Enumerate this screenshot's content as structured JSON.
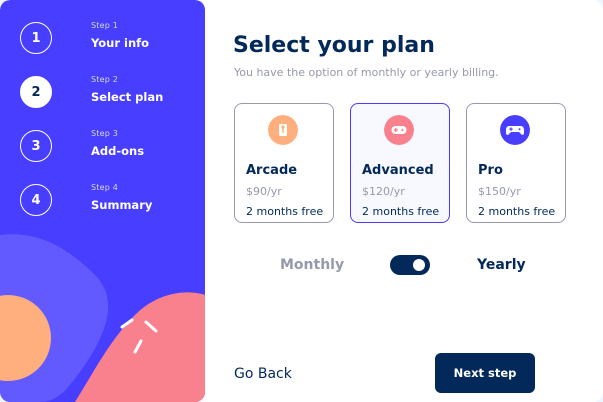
{
  "sidebar": {
    "steps": [
      {
        "circle": "1",
        "step": "Step 1",
        "label": "Your info",
        "active": false
      },
      {
        "circle": "2",
        "step": "Step 2",
        "label": "Select plan",
        "active": true
      },
      {
        "circle": "3",
        "step": "Step 3",
        "label": "Add-ons",
        "active": false
      },
      {
        "circle": "4",
        "step": "Step 4",
        "label": "Summary",
        "active": false
      }
    ]
  },
  "main": {
    "title": "Select your plan",
    "subtitle": "You have the option of monthly or yearly billing.",
    "plans": [
      {
        "icon": "arcade-icon",
        "name": "Arcade",
        "price": "$90/yr",
        "free": "2 months free",
        "selected": false,
        "icon_color": "#ffaf7e"
      },
      {
        "icon": "advanced-icon",
        "name": "Advanced",
        "price": "$120/yr",
        "free": "2 months free",
        "selected": true,
        "icon_color": "#f9818e"
      },
      {
        "icon": "pro-icon",
        "name": "Pro",
        "price": "$150/yr",
        "free": "2 months free",
        "selected": false,
        "icon_color": "#483eff"
      }
    ],
    "billing": {
      "monthly_label": "Monthly",
      "yearly_label": "Yearly",
      "selected": "Yearly"
    },
    "footer": {
      "back_label": "Go Back",
      "next_label": "Next step"
    }
  },
  "colors": {
    "sidebar_bg": "#483eff",
    "marine_blue": "#02295a",
    "cool_gray": "#9699ab",
    "pastel_orange": "#ffaf7e",
    "light_red": "#f9818e"
  }
}
